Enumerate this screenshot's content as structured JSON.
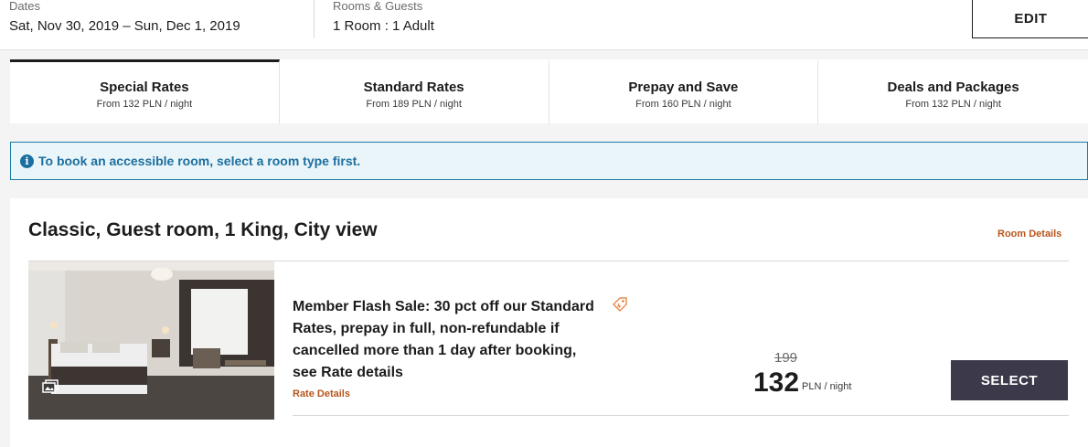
{
  "search": {
    "dates_label": "Dates",
    "dates_value": "Sat, Nov 30, 2019 – Sun, Dec 1, 2019",
    "rooms_label": "Rooms & Guests",
    "rooms_value": "1 Room : 1 Adult",
    "edit_label": "EDIT"
  },
  "tabs": [
    {
      "title": "Special Rates",
      "sub": "From 132 PLN / night",
      "active": true
    },
    {
      "title": "Standard Rates",
      "sub": "From 189 PLN / night",
      "active": false
    },
    {
      "title": "Prepay and Save",
      "sub": "From 160 PLN / night",
      "active": false
    },
    {
      "title": "Deals and Packages",
      "sub": "From 132 PLN / night",
      "active": false
    }
  ],
  "banner": {
    "icon": "info-icon",
    "message": "To book an accessible room, select a room type first."
  },
  "room": {
    "title": "Classic, Guest room, 1 King, City view",
    "details_link": "Room Details",
    "gallery_icon": "gallery-icon",
    "rate": {
      "description": "Member Flash Sale: 30 pct off our Standard Rates, prepay in full, non-refundable if cancelled more than 1 day after booking, see Rate details",
      "details_link": "Rate Details",
      "tag_icon": "tag-icon",
      "old_price": "199",
      "price": "132",
      "price_unit": "PLN / night",
      "select_label": "SELECT"
    }
  },
  "colors": {
    "accent_link": "#b8551c",
    "info_blue": "#1b6fa0",
    "select_button": "#3c3a4a"
  }
}
